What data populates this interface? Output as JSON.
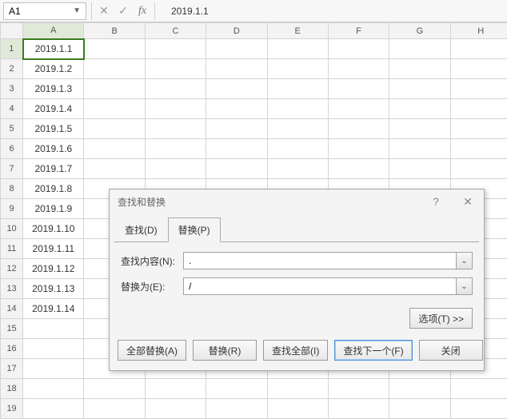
{
  "namebox": {
    "value": "A1"
  },
  "formula_bar": {
    "value": "2019.1.1"
  },
  "columns": [
    "A",
    "B",
    "C",
    "D",
    "E",
    "F",
    "G",
    "H"
  ],
  "rows": [
    {
      "n": 1,
      "a": "2019.1.1"
    },
    {
      "n": 2,
      "a": "2019.1.2"
    },
    {
      "n": 3,
      "a": "2019.1.3"
    },
    {
      "n": 4,
      "a": "2019.1.4"
    },
    {
      "n": 5,
      "a": "2019.1.5"
    },
    {
      "n": 6,
      "a": "2019.1.6"
    },
    {
      "n": 7,
      "a": "2019.1.7"
    },
    {
      "n": 8,
      "a": "2019.1.8"
    },
    {
      "n": 9,
      "a": "2019.1.9"
    },
    {
      "n": 10,
      "a": "2019.1.10"
    },
    {
      "n": 11,
      "a": "2019.1.11"
    },
    {
      "n": 12,
      "a": "2019.1.12"
    },
    {
      "n": 13,
      "a": "2019.1.13"
    },
    {
      "n": 14,
      "a": "2019.1.14"
    },
    {
      "n": 15,
      "a": ""
    },
    {
      "n": 16,
      "a": ""
    },
    {
      "n": 17,
      "a": ""
    },
    {
      "n": 18,
      "a": ""
    },
    {
      "n": 19,
      "a": ""
    }
  ],
  "dialog": {
    "title": "查找和替换",
    "tabs": {
      "find": "查找(D)",
      "replace": "替换(P)"
    },
    "labels": {
      "find_what": "查找内容(N):",
      "replace_with": "替换为(E):"
    },
    "values": {
      "find_what": ".",
      "replace_with": "/"
    },
    "options_btn": "选项(T) >>",
    "buttons": {
      "replace_all": "全部替换(A)",
      "replace": "替换(R)",
      "find_all": "查找全部(I)",
      "find_next": "查找下一个(F)",
      "close": "关闭"
    }
  }
}
